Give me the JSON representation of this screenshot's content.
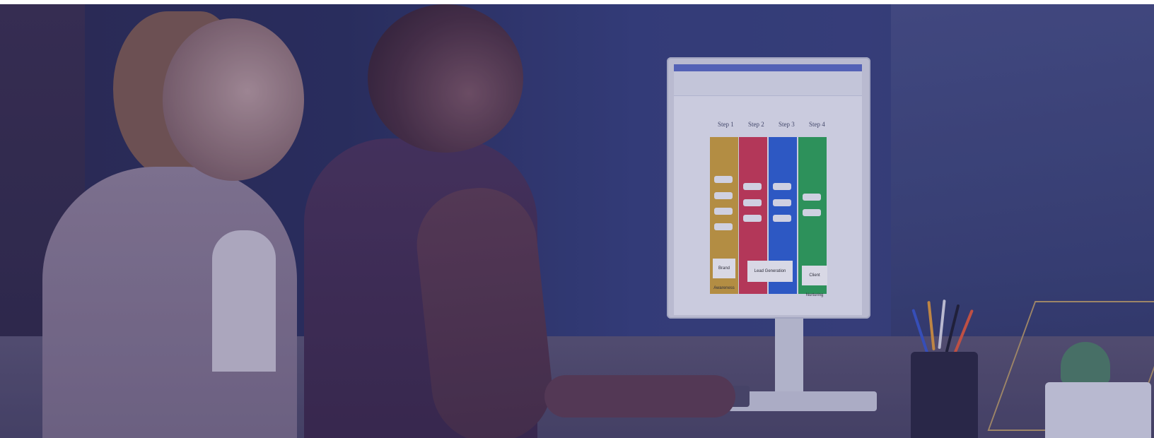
{
  "screen": {
    "step_titles": [
      "Step 1",
      "Step 2",
      "Step 3",
      "Step 4"
    ],
    "columns": [
      {
        "color": "#d2a43a"
      },
      {
        "color": "#d23b55"
      },
      {
        "color": "#2f63d6"
      },
      {
        "color": "#2fa957"
      }
    ],
    "bottom_labels": [
      "Brand Awareness",
      "Lead Generation",
      "Client Nurturing"
    ]
  },
  "colors": {
    "overlay": "#2b2f66"
  }
}
